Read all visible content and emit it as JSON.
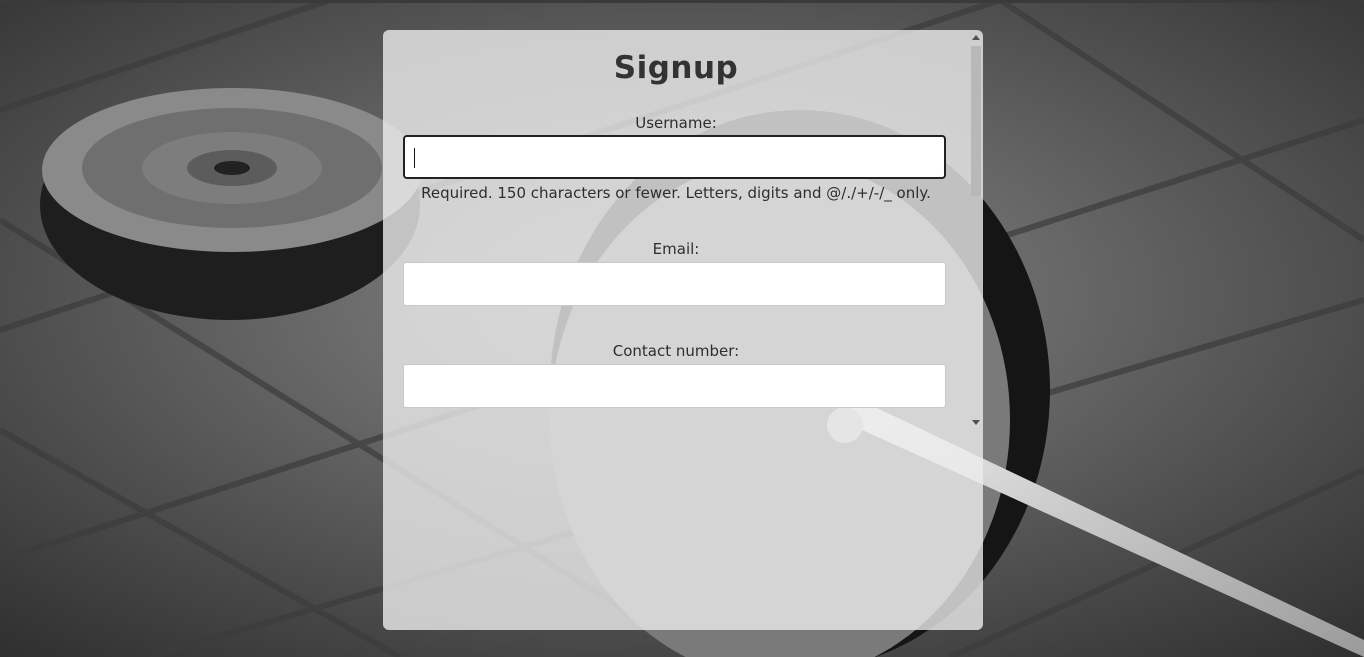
{
  "form": {
    "title": "Signup",
    "username": {
      "label": "Username:",
      "value": "",
      "placeholder": "",
      "help_text": "Required. 150 characters or fewer. Letters, digits and @/./+/-/_ only."
    },
    "email": {
      "label": "Email:",
      "value": "",
      "placeholder": ""
    },
    "contact_number": {
      "label": "Contact number:",
      "value": "",
      "placeholder": ""
    }
  },
  "colors": {
    "panel": "#ececec",
    "text": "#2e2e2e",
    "focus_border": "#222222"
  },
  "background": {
    "description_icon": "barbell-photo"
  }
}
